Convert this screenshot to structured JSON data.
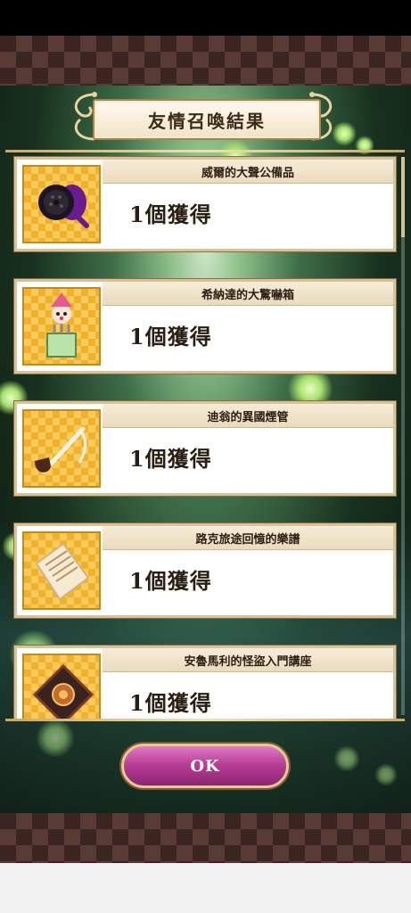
{
  "header": {
    "title": "友情召喚結果"
  },
  "items": [
    {
      "name": "威爾的大聲公備品",
      "count": "1個獲得",
      "icon": "megaphone-icon"
    },
    {
      "name": "希納達的大驚嚇箱",
      "count": "1個獲得",
      "icon": "jack-in-the-box-icon"
    },
    {
      "name": "迪翁的異國煙管",
      "count": "1個獲得",
      "icon": "pipe-icon"
    },
    {
      "name": "路克旅途回憶的樂譜",
      "count": "1個獲得",
      "icon": "sheet-music-icon"
    },
    {
      "name": "安魯馬利的怪盜入門講座",
      "count": "1個獲得",
      "icon": "book-icon"
    }
  ],
  "footer": {
    "ok_label": "OK"
  },
  "colors": {
    "accent": "#b83f97",
    "frame": "#c9a765",
    "icon_bg": "#f0b22d"
  }
}
